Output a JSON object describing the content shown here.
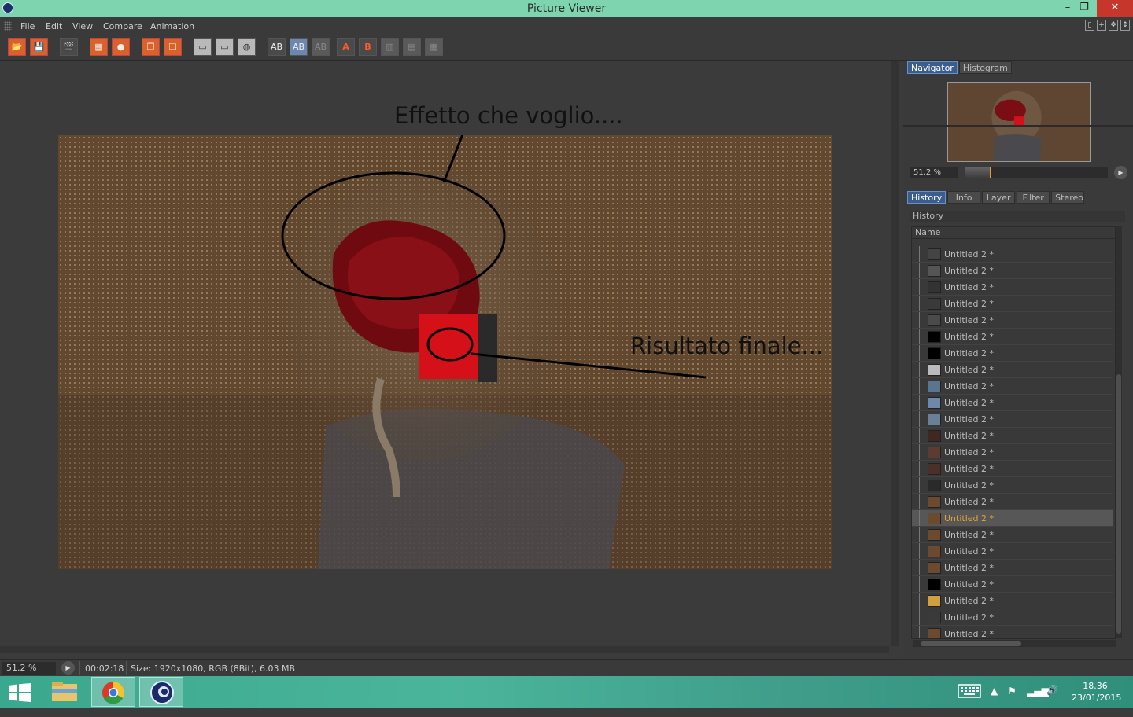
{
  "window": {
    "title": "Picture Viewer",
    "minimize": "–",
    "restore": "❐",
    "close": "✕"
  },
  "menu": [
    "File",
    "Edit",
    "View",
    "Compare",
    "Animation"
  ],
  "toolbar_labels": {
    "a_label": "A",
    "b_label": "B"
  },
  "annotations": {
    "top": "Effetto che voglio....",
    "right": "Risultato finale..."
  },
  "navigator": {
    "tabs": [
      "Navigator",
      "Histogram"
    ],
    "zoom": "51.2 %",
    "zoom_level_percent": 51.2
  },
  "panel_tabs": [
    "History",
    "Info",
    "Layer",
    "Filter",
    "Stereo"
  ],
  "history": {
    "title": "History",
    "column": "Name",
    "items": [
      {
        "name": "Untitled 2 *"
      },
      {
        "name": "Untitled 2 *"
      },
      {
        "name": "Untitled 2 *"
      },
      {
        "name": "Untitled 2 *"
      },
      {
        "name": "Untitled 2 *"
      },
      {
        "name": "Untitled 2 *"
      },
      {
        "name": "Untitled 2 *"
      },
      {
        "name": "Untitled 2 *"
      },
      {
        "name": "Untitled 2 *"
      },
      {
        "name": "Untitled 2 *"
      },
      {
        "name": "Untitled 2 *"
      },
      {
        "name": "Untitled 2 *"
      },
      {
        "name": "Untitled 2 *"
      },
      {
        "name": "Untitled 2 *"
      },
      {
        "name": "Untitled 2 *"
      },
      {
        "name": "Untitled 2 *"
      },
      {
        "name": "Untitled 2 *"
      },
      {
        "name": "Untitled 2 *"
      },
      {
        "name": "Untitled 2 *"
      },
      {
        "name": "Untitled 2 *"
      },
      {
        "name": "Untitled 2 *"
      },
      {
        "name": "Untitled 2 *"
      },
      {
        "name": "Untitled 2 *"
      },
      {
        "name": "Untitled 2 *"
      },
      {
        "name": "Untitled 2"
      }
    ],
    "selected_index": 16
  },
  "status": {
    "zoom": "51.2 %",
    "time": "00:02:18",
    "size": "Size: 1920x1080, RGB (8Bit), 6.03 MB"
  },
  "clock": {
    "time": "18.36",
    "date": "23/01/2015"
  },
  "colors": {
    "title_bar": "#7fd4b0",
    "selected_text": "#e8a030",
    "tab_active": "#3c5d8c"
  }
}
